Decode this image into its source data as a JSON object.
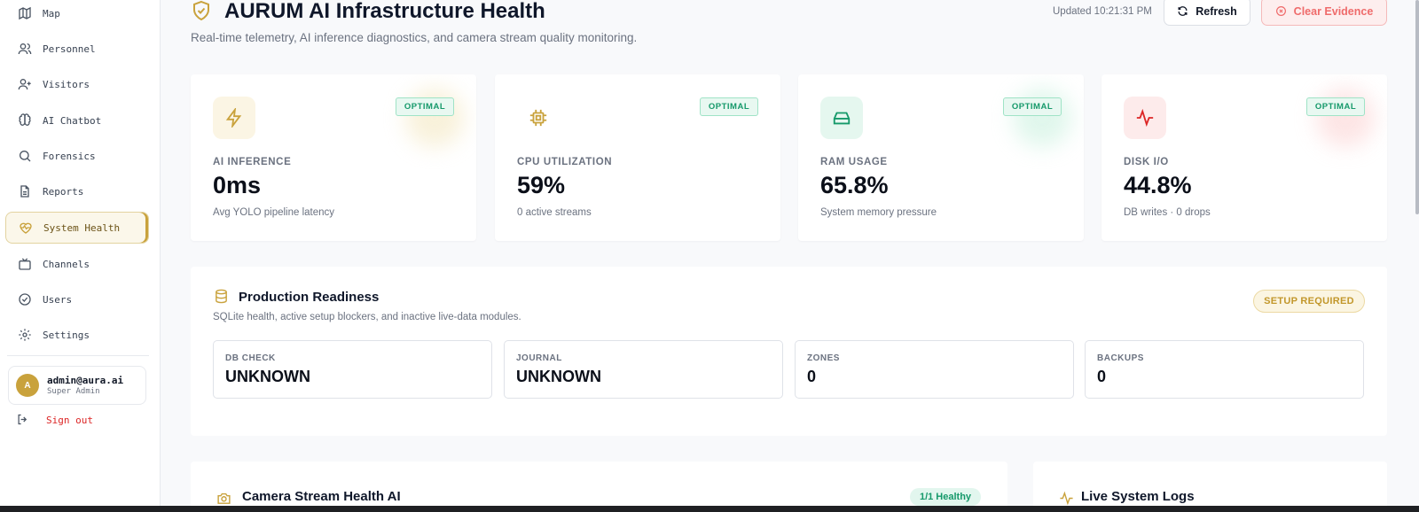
{
  "sidebar": {
    "items": [
      {
        "label": "Map",
        "icon": "map-icon"
      },
      {
        "label": "Personnel",
        "icon": "users-icon"
      },
      {
        "label": "Visitors",
        "icon": "user-plus-icon"
      },
      {
        "label": "AI Chatbot",
        "icon": "brain-icon"
      },
      {
        "label": "Forensics",
        "icon": "search-icon"
      },
      {
        "label": "Reports",
        "icon": "file-text-icon"
      },
      {
        "label": "System Health",
        "icon": "heart-pulse-icon",
        "active": true
      },
      {
        "label": "Channels",
        "icon": "tv-icon"
      },
      {
        "label": "Users",
        "icon": "check-circle-icon"
      },
      {
        "label": "Settings",
        "icon": "gear-icon"
      }
    ],
    "user": {
      "initial": "A",
      "email": "admin@aura.ai",
      "role": "Super Admin"
    },
    "signout_label": "Sign out"
  },
  "header": {
    "title": "AURUM AI Infrastructure Health",
    "subtitle": "Real-time telemetry, AI inference diagnostics, and camera stream quality monitoring.",
    "updated": "Updated 10:21:31 PM",
    "refresh_label": "Refresh",
    "clear_label": "Clear Evidence"
  },
  "stats": [
    {
      "label": "AI INFERENCE",
      "value": "0ms",
      "sub": "Avg YOLO pipeline latency",
      "status": "OPTIMAL",
      "icon": "lightning-icon",
      "color": "#c9a23c"
    },
    {
      "label": "CPU UTILIZATION",
      "value": "59%",
      "sub": "0 active streams",
      "status": "OPTIMAL",
      "icon": "cpu-icon",
      "color": "#c9a23c"
    },
    {
      "label": "RAM USAGE",
      "value": "65.8%",
      "sub": "System memory pressure",
      "status": "OPTIMAL",
      "icon": "hard-drive-icon",
      "color": "#15996a"
    },
    {
      "label": "DISK I/O",
      "value": "44.8%",
      "sub": "DB writes · 0 drops",
      "status": "OPTIMAL",
      "icon": "activity-icon",
      "color": "#dc2626"
    }
  ],
  "readiness": {
    "title": "Production Readiness",
    "subtitle": "SQLite health, active setup blockers, and inactive live-data modules.",
    "badge": "SETUP REQUIRED",
    "cards": [
      {
        "label": "DB CHECK",
        "value": "UNKNOWN"
      },
      {
        "label": "JOURNAL",
        "value": "UNKNOWN"
      },
      {
        "label": "ZONES",
        "value": "0"
      },
      {
        "label": "BACKUPS",
        "value": "0"
      }
    ]
  },
  "camera_panel": {
    "title": "Camera Stream Health AI",
    "badge": "1/1 Healthy"
  },
  "logs_panel": {
    "title": "Live System Logs"
  }
}
